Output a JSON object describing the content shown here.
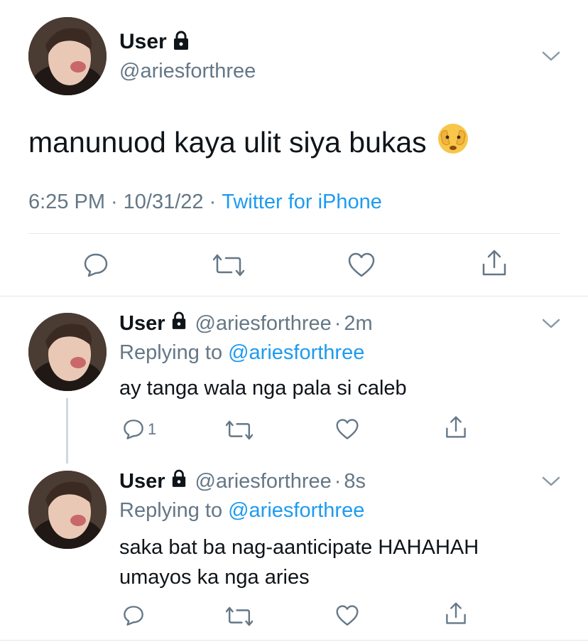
{
  "main_tweet": {
    "display_name": "User",
    "handle": "@ariesforthree",
    "text": "manunuod kaya ulit siya bukas",
    "emoji": "🫣",
    "time": "6:25 PM",
    "sep1": "·",
    "date": "10/31/22",
    "sep2": "·",
    "source": "Twitter for iPhone"
  },
  "replies": [
    {
      "display_name": "User",
      "handle": "@ariesforthree",
      "sep": "·",
      "age": "2m",
      "replying_prefix": "Replying to",
      "replying_handle": "@ariesforthree",
      "text_line1": "ay tanga wala nga pala si caleb",
      "text_line2": "",
      "reply_count": "1"
    },
    {
      "display_name": "User",
      "handle": "@ariesforthree",
      "sep": "·",
      "age": "8s",
      "replying_prefix": "Replying to",
      "replying_handle": "@ariesforthree",
      "text_line1": "saka bat ba nag-aanticipate HAHAHAH",
      "text_line2": "umayos ka nga aries",
      "reply_count": ""
    }
  ],
  "colors": {
    "text": "#0f1419",
    "secondary": "#657786",
    "accent": "#1d9bf0",
    "divider": "#e1e8ed"
  },
  "icons": [
    "lock-icon",
    "chevron-down-icon",
    "reply-icon",
    "retweet-icon",
    "like-icon",
    "share-icon"
  ]
}
